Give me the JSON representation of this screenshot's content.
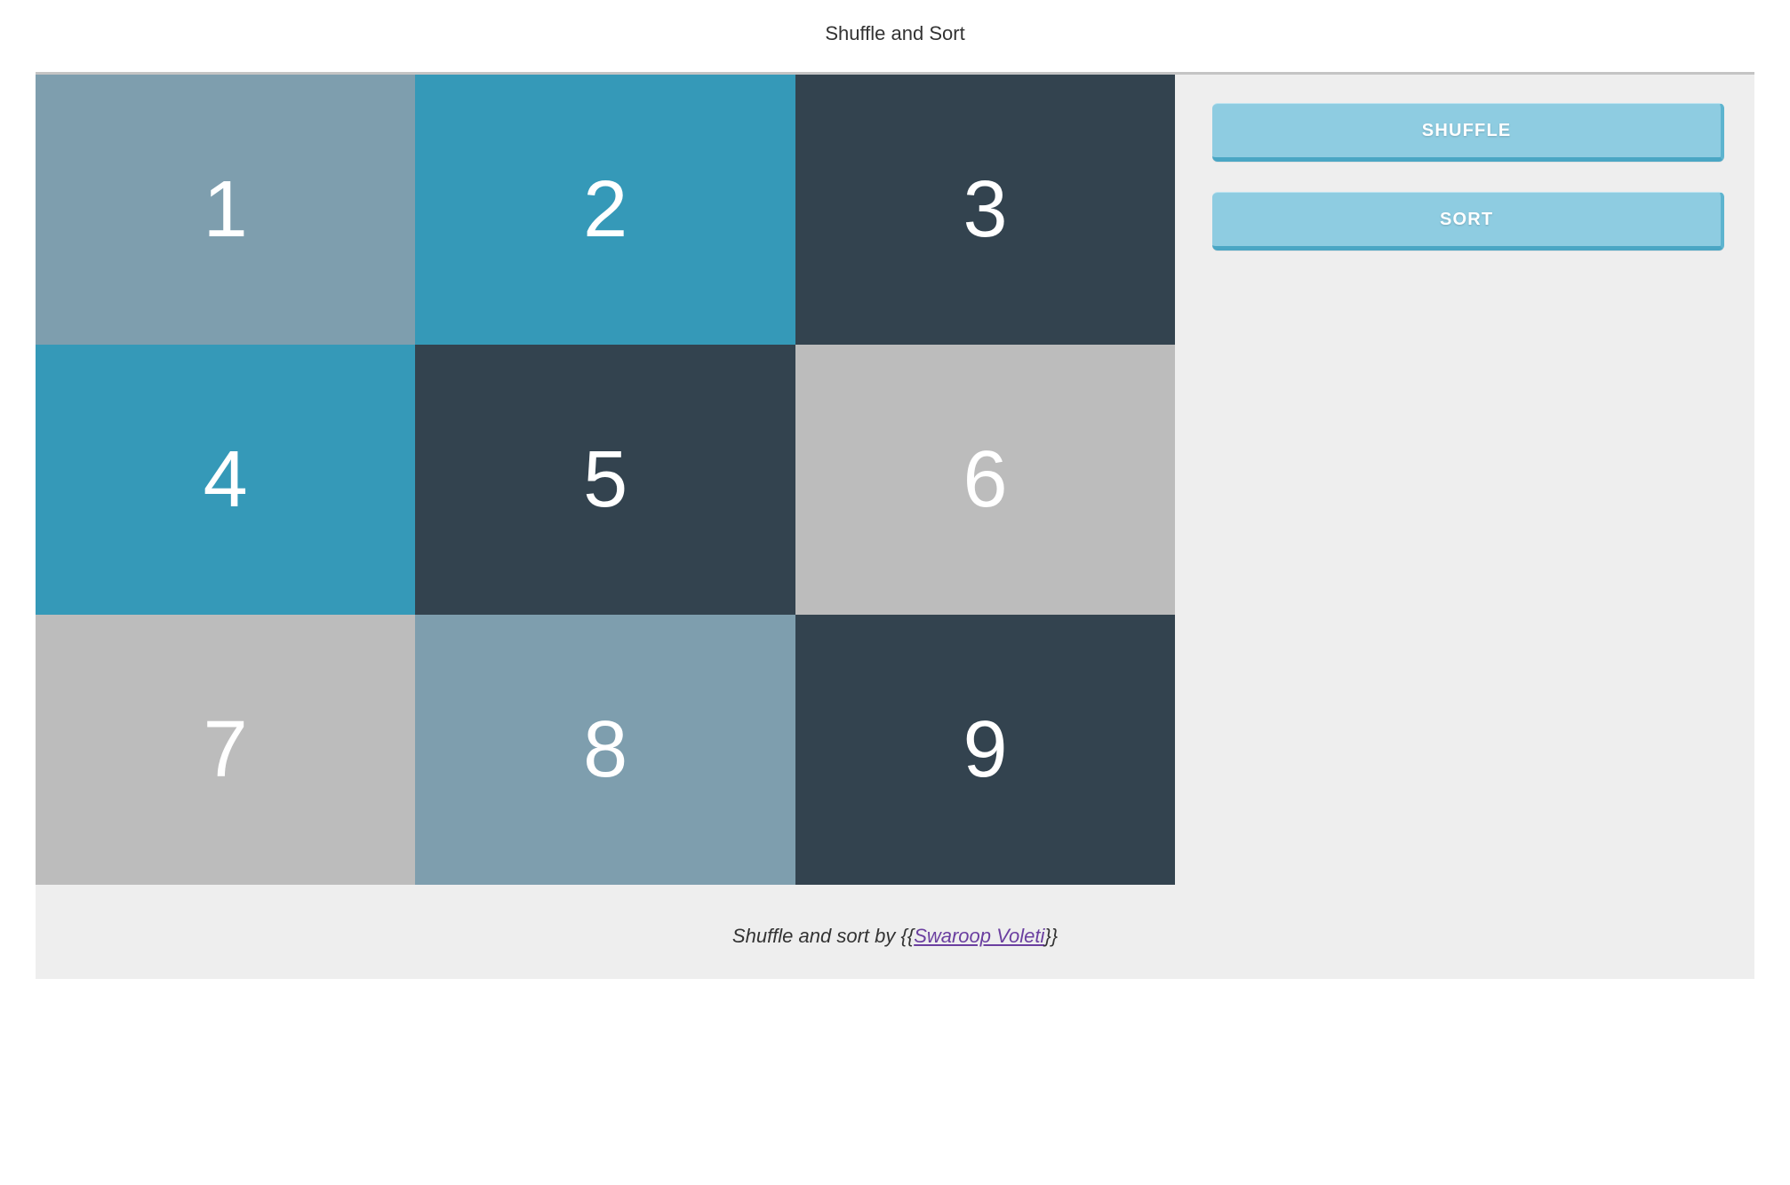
{
  "title": "Shuffle and Sort",
  "tiles": [
    {
      "value": "1",
      "color": "slate"
    },
    {
      "value": "2",
      "color": "teal"
    },
    {
      "value": "3",
      "color": "dark"
    },
    {
      "value": "4",
      "color": "teal"
    },
    {
      "value": "5",
      "color": "dark"
    },
    {
      "value": "6",
      "color": "lightgray"
    },
    {
      "value": "7",
      "color": "lightgray"
    },
    {
      "value": "8",
      "color": "slate"
    },
    {
      "value": "9",
      "color": "dark"
    }
  ],
  "controls": {
    "shuffle_label": "SHUFFLE",
    "sort_label": "SORT"
  },
  "footer": {
    "prefix": "Shuffle and sort by ",
    "author_wrapped": "{{Swaroop Voleti}}",
    "author": "Swaroop Voleti"
  },
  "colors": {
    "slate": "#7e9eae",
    "teal": "#3599b8",
    "dark": "#33434f",
    "lightgray": "#bcbcbc",
    "button_bg": "#8ecce1",
    "button_edge": "#4aa6c4",
    "link": "#6b3fa0"
  }
}
